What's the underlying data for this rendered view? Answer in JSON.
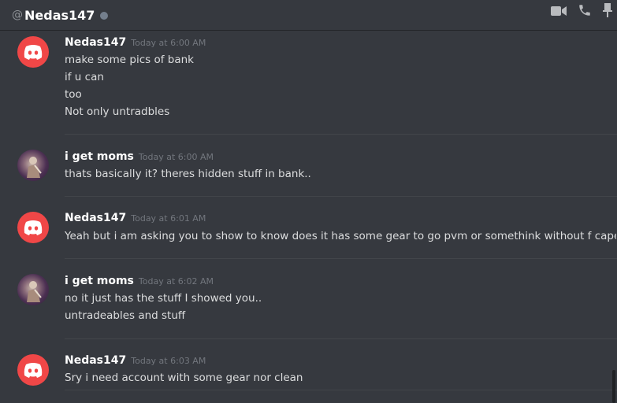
{
  "header": {
    "at_symbol": "@",
    "username": "Nedas147",
    "status": "offline",
    "icons": [
      "video-call-icon",
      "voice-call-icon",
      "pin-icon"
    ]
  },
  "messages": [
    {
      "author": "Nedas147",
      "avatar": "discord-default-avatar",
      "timestamp": "Today at 6:00 AM",
      "lines": [
        "make some pics of bank",
        "if u can",
        "too",
        "Not only untradbles"
      ]
    },
    {
      "author": "i get moms",
      "avatar": "user-photo-avatar",
      "timestamp": "Today at 6:00 AM",
      "lines": [
        "thats basically it? theres hidden stuff in bank.."
      ]
    },
    {
      "author": "Nedas147",
      "avatar": "discord-default-avatar",
      "timestamp": "Today at 6:01 AM",
      "lines": [
        "Yeah but i am asking you to show to know does it has some gear to go pvm or somethink without f capes graceful"
      ]
    },
    {
      "author": "i get moms",
      "avatar": "user-photo-avatar",
      "timestamp": "Today at 6:02 AM",
      "lines": [
        "no it just has the stuff I showed you..",
        "untradeables and stuff"
      ]
    },
    {
      "author": "Nedas147",
      "avatar": "discord-default-avatar",
      "timestamp": "Today at 6:03 AM",
      "lines": [
        "Sry i need account with some gear nor clean"
      ]
    }
  ],
  "colors": {
    "background": "#36393f",
    "discord_red": "#f04747",
    "text": "#dcddde",
    "timestamp": "#72767d"
  }
}
